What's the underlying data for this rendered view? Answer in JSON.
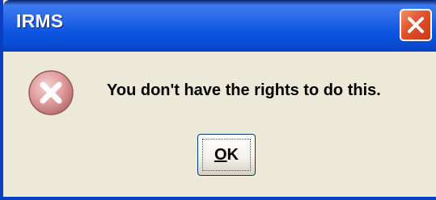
{
  "window": {
    "title": "IRMS"
  },
  "dialog": {
    "message": "You don't have the rights to do this.",
    "icon": "error-icon"
  },
  "buttons": {
    "ok_mnemonic": "O",
    "ok_rest": "K"
  },
  "icons": {
    "close": "close-icon"
  },
  "colors": {
    "title_bar": "#0a54df",
    "dialog_background": "#ece9d8",
    "close_button": "#e2512b"
  }
}
